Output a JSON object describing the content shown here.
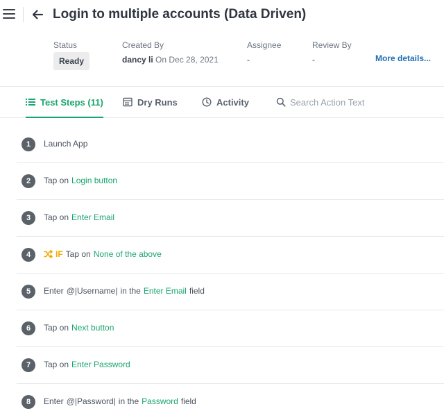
{
  "header": {
    "title": "Login to multiple accounts (Data Driven)"
  },
  "meta": {
    "status_label": "Status",
    "status_value": "Ready",
    "created_by_label": "Created By",
    "created_by_name": "dancy li",
    "created_on": "On Dec 28, 2021",
    "assignee_label": "Assignee",
    "assignee_value": "-",
    "review_by_label": "Review By",
    "review_by_value": "-",
    "more_details": "More details..."
  },
  "tabs": [
    {
      "label": "Test Steps (11)",
      "icon": "list-icon",
      "active": true
    },
    {
      "label": "Dry Runs",
      "icon": "calendar-grid-icon",
      "active": false
    },
    {
      "label": "Activity",
      "icon": "clock-icon",
      "active": false
    }
  ],
  "search": {
    "placeholder": "Search Action Text"
  },
  "steps": [
    {
      "num": "1",
      "action": "Launch App"
    },
    {
      "num": "2",
      "action": "Tap on",
      "target": "Login button"
    },
    {
      "num": "3",
      "action": "Tap on",
      "target": "Enter Email"
    },
    {
      "num": "4",
      "condition": "IF",
      "action": "Tap on",
      "target": "None of the above"
    },
    {
      "num": "5",
      "action": "Enter",
      "param": "@|Username|",
      "mid": "in the",
      "target": "Enter Email",
      "tail": "field"
    },
    {
      "num": "6",
      "action": "Tap on",
      "target": "Next button"
    },
    {
      "num": "7",
      "action": "Tap on",
      "target": "Enter Password"
    },
    {
      "num": "8",
      "action": "Enter",
      "param": "@|Password|",
      "mid": "in the",
      "target": "Password",
      "tail": "field"
    }
  ],
  "colors": {
    "accent": "#1aa570",
    "link": "#1f6fb5",
    "if": "#f2a900",
    "step_badge": "#5b6168"
  }
}
